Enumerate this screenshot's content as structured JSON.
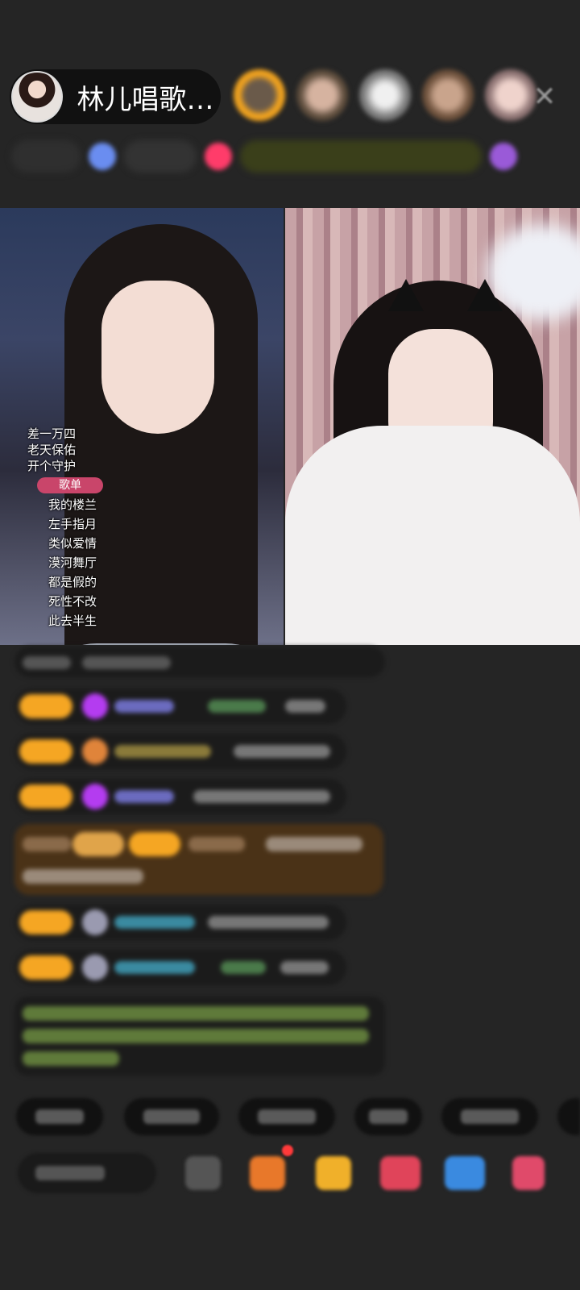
{
  "header": {
    "host_name": "林儿唱歌…"
  },
  "overlay": {
    "line1": "差一万四",
    "line2": "老天保佑",
    "line3": "开个守护",
    "song_button": "歌单"
  },
  "song_list": [
    "我的楼兰",
    "左手指月",
    "类似爱情",
    "漠河舞厅",
    "都是假的",
    "死性不改",
    "此去半生"
  ],
  "icons": {
    "close": "close-icon",
    "gift": "gift-icon",
    "more": "more-icon"
  },
  "colors": {
    "background": "#252525",
    "level_badge": "#f5a623",
    "song_button": "#c9456a",
    "chat_highlight": "#5a3a16"
  }
}
